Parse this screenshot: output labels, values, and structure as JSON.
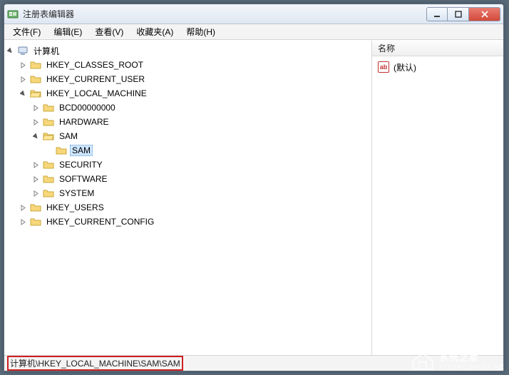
{
  "window": {
    "title": "注册表编辑器"
  },
  "menu": {
    "file": "文件(F)",
    "edit": "编辑(E)",
    "view": "查看(V)",
    "fav": "收藏夹(A)",
    "help": "帮助(H)"
  },
  "tree": {
    "root": "计算机",
    "hkcr": "HKEY_CLASSES_ROOT",
    "hkcu": "HKEY_CURRENT_USER",
    "hklm": "HKEY_LOCAL_MACHINE",
    "hklm_children": {
      "bcd": "BCD00000000",
      "hw": "HARDWARE",
      "sam": "SAM",
      "sam_child": "SAM",
      "sec": "SECURITY",
      "sw": "SOFTWARE",
      "sys": "SYSTEM"
    },
    "hku": "HKEY_USERS",
    "hkcc": "HKEY_CURRENT_CONFIG"
  },
  "list": {
    "header_name": "名称",
    "default_value": "(默认)"
  },
  "status": {
    "path": "计算机\\HKEY_LOCAL_MACHINE\\SAM\\SAM"
  },
  "watermark": {
    "line1": "系统之家",
    "line2": "XITONGZHIJIA.NE"
  }
}
